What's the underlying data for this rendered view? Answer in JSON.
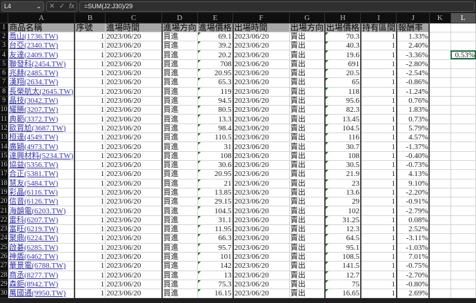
{
  "formula_bar": {
    "name_box": "L4",
    "cancel": "✕",
    "confirm": "✓",
    "fx": "fx",
    "formula": "=SUM(J2:J30)/29"
  },
  "columns": [
    "A",
    "B",
    "C",
    "D",
    "E",
    "F",
    "G",
    "H",
    "I",
    "J",
    "K",
    "L"
  ],
  "selected_column": "L",
  "headers": [
    "商品名稱",
    "序號",
    "進場時間",
    "進場方向",
    "進場價格",
    "出場時間",
    "出場方向",
    "出場價格",
    "持有區間",
    "報酬率"
  ],
  "rows": [
    [
      "喬山(1736.TW)",
      "1",
      "2023/06/20",
      "買進",
      "69.1",
      "2023/06/20",
      "賣出",
      "70.3",
      "1",
      "1.33%"
    ],
    [
      "台亞(2340.TW)",
      "1",
      "2023/06/20",
      "買進",
      "39.2",
      "2023/06/20",
      "賣出",
      "40.3",
      "1",
      "2.40%"
    ],
    [
      "友達(2409.TW)",
      "1",
      "2023/06/20",
      "買進",
      "20.2",
      "2023/06/20",
      "賣出",
      "19.6",
      "1",
      "-3.36%"
    ],
    [
      "聯發科(2454.TW)",
      "1",
      "2023/06/20",
      "買進",
      "708",
      "2023/06/20",
      "賣出",
      "691",
      "1",
      "-2.80%"
    ],
    [
      "兆赫(2485.TW)",
      "1",
      "2023/06/20",
      "買進",
      "20.95",
      "2023/06/20",
      "賣出",
      "20.5",
      "1",
      "-2.54%"
    ],
    [
      "漢翔(2634.TW)",
      "1",
      "2023/06/20",
      "買進",
      "65.3",
      "2023/06/20",
      "賣出",
      "65",
      "1",
      "-0.86%"
    ],
    [
      "長榮航太(2645.TW)",
      "1",
      "2023/06/20",
      "買進",
      "119",
      "2023/06/20",
      "賣出",
      "118",
      "1",
      "-1.24%"
    ],
    [
      "晶技(3042.TW)",
      "1",
      "2023/06/20",
      "買進",
      "94.5",
      "2023/06/20",
      "賣出",
      "95.6",
      "1",
      "0.76%"
    ],
    [
      "耀勝(3207.TW)",
      "1",
      "2023/06/20",
      "買進",
      "80.5",
      "2023/06/20",
      "賣出",
      "82.3",
      "1",
      "1.83%"
    ],
    [
      "典範(3372.TW)",
      "1",
      "2023/06/20",
      "買進",
      "13.3",
      "2023/06/20",
      "賣出",
      "13.45",
      "1",
      "0.73%"
    ],
    [
      "歐買尬(3687.TW)",
      "1",
      "2023/06/20",
      "買進",
      "98.4",
      "2023/06/20",
      "賣出",
      "104.5",
      "1",
      "5.79%"
    ],
    [
      "桓達(4549.TW)",
      "1",
      "2023/06/20",
      "買進",
      "110.5",
      "2023/06/20",
      "賣出",
      "116",
      "1",
      "4.57%"
    ],
    [
      "廣穎(4973.TW)",
      "1",
      "2023/06/20",
      "買進",
      "31",
      "2023/06/20",
      "賣出",
      "30.7",
      "1",
      "-1.37%"
    ],
    [
      "達興材料(5234.TW)",
      "1",
      "2023/06/20",
      "買進",
      "108",
      "2023/06/20",
      "賣出",
      "108",
      "1",
      "-0.40%"
    ],
    [
      "協益(5356.TW)",
      "1",
      "2023/06/20",
      "買進",
      "30.6",
      "2023/06/20",
      "賣出",
      "30.5",
      "1",
      "-0.73%"
    ],
    [
      "合正(5381.TW)",
      "1",
      "2023/06/20",
      "買進",
      "20.95",
      "2023/06/20",
      "賣出",
      "21.9",
      "1",
      "4.13%"
    ],
    [
      "慧友(5484.TW)",
      "1",
      "2023/06/20",
      "買進",
      "21",
      "2023/06/20",
      "賣出",
      "23",
      "1",
      "9.10%"
    ],
    [
      "彩晶(6116.TW)",
      "1",
      "2023/06/20",
      "買進",
      "13.85",
      "2023/06/20",
      "賣出",
      "13.6",
      "1",
      "-2.20%"
    ],
    [
      "信音(6126.TW)",
      "1",
      "2023/06/20",
      "買進",
      "29.15",
      "2023/06/20",
      "賣出",
      "29",
      "1",
      "-0.91%"
    ],
    [
      "海韻電(6203.TW)",
      "1",
      "2023/06/20",
      "買進",
      "104.5",
      "2023/06/20",
      "賣出",
      "102",
      "1",
      "-2.79%"
    ],
    [
      "雷科(6207.TW)",
      "1",
      "2023/06/20",
      "買進",
      "31.1",
      "2023/06/20",
      "賣出",
      "31.25",
      "1",
      "0.08%"
    ],
    [
      "富旺(6219.TW)",
      "1",
      "2023/06/20",
      "買進",
      "11.95",
      "2023/06/20",
      "賣出",
      "12.3",
      "1",
      "2.52%"
    ],
    [
      "聚鼎(6224.TW)",
      "1",
      "2023/06/20",
      "買進",
      "66.3",
      "2023/06/20",
      "賣出",
      "64.5",
      "1",
      "-3.11%"
    ],
    [
      "啟碁(6285.TW)",
      "1",
      "2023/06/20",
      "買進",
      "95.7",
      "2023/06/20",
      "賣出",
      "95.1",
      "1",
      "-1.03%"
    ],
    [
      "神盾(6462.TW)",
      "1",
      "2023/06/20",
      "買進",
      "101",
      "2023/06/20",
      "賣出",
      "108.5",
      "1",
      "7.01%"
    ],
    [
      "華景電(6788.TW)",
      "1",
      "2023/06/20",
      "買進",
      "142",
      "2023/06/20",
      "賣出",
      "141.5",
      "1",
      "-0.75%"
    ],
    [
      "商丞(8277.TW)",
      "1",
      "2023/06/20",
      "買進",
      "13",
      "2023/06/20",
      "賣出",
      "12.7",
      "1",
      "-2.70%"
    ],
    [
      "森鉅(8942.TW)",
      "1",
      "2023/06/20",
      "買進",
      "75.3",
      "2023/06/20",
      "賣出",
      "75",
      "1",
      "-0.80%"
    ],
    [
      "萬國通(9950.TW)",
      "1",
      "2023/06/20",
      "買進",
      "16.15",
      "2023/06/20",
      "賣出",
      "16.65",
      "1",
      "2.69%"
    ]
  ],
  "active_cell": {
    "ref": "L4",
    "value": "0.53%"
  },
  "colors": {
    "header_fill": "#a6a6a6",
    "link": "#3333aa",
    "selection": "#217346",
    "error_triangle": "#1a7a1a"
  }
}
